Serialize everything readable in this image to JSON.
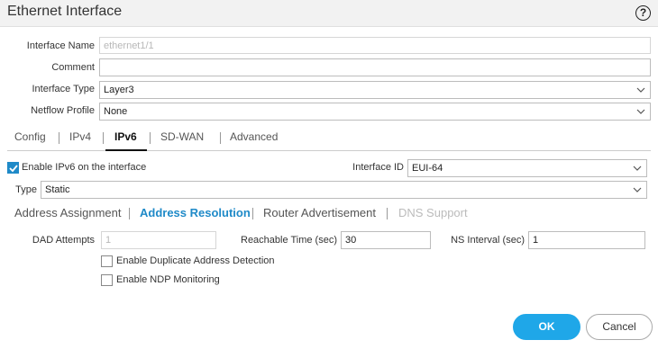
{
  "dialog": {
    "title": "Ethernet Interface",
    "help_icon_glyph": "?"
  },
  "fields": {
    "interface_name_label": "Interface Name",
    "interface_name_value": "ethernet1/1",
    "comment_label": "Comment",
    "comment_value": "",
    "interface_type_label": "Interface Type",
    "interface_type_value": "Layer3",
    "netflow_profile_label": "Netflow Profile",
    "netflow_profile_value": "None"
  },
  "tabs": [
    {
      "label": "Config",
      "active": false
    },
    {
      "label": "IPv4",
      "active": false
    },
    {
      "label": "IPv6",
      "active": true
    },
    {
      "label": "SD-WAN",
      "active": false
    },
    {
      "label": "Advanced",
      "active": false
    }
  ],
  "ipv6": {
    "enable_label": "Enable IPv6 on the interface",
    "enable_checked": true,
    "interface_id_label": "Interface ID",
    "interface_id_value": "EUI-64",
    "type_label": "Type",
    "type_value": "Static"
  },
  "subtabs": [
    {
      "label": "Address Assignment",
      "state": "normal"
    },
    {
      "label": "Address Resolution",
      "state": "active"
    },
    {
      "label": "Router Advertisement",
      "state": "normal"
    },
    {
      "label": "DNS Support",
      "state": "disabled"
    }
  ],
  "address_resolution": {
    "dad_attempts_label": "DAD Attempts",
    "dad_attempts_value": "1",
    "reachable_time_label": "Reachable Time (sec)",
    "reachable_time_value": "30",
    "ns_interval_label": "NS Interval (sec)",
    "ns_interval_value": "1",
    "enable_dad_label": "Enable Duplicate Address Detection",
    "enable_dad_checked": false,
    "enable_ndp_label": "Enable NDP Monitoring",
    "enable_ndp_checked": false
  },
  "buttons": {
    "ok_label": "OK",
    "cancel_label": "Cancel"
  },
  "colors": {
    "accent": "#1f8ac8",
    "ok_button": "#1fa7e8"
  }
}
